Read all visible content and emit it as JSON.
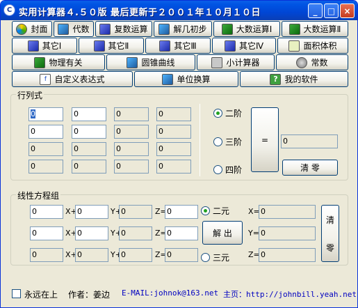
{
  "window": {
    "title": "实用计算器４.５０版  最后更新于２００１年１０月１０日",
    "minimize": "_",
    "maximize": "□",
    "close": "×"
  },
  "toolbar": {
    "row1": [
      "封面",
      "代数",
      "复数运算",
      "解几初步",
      "大数运算Ⅰ",
      "大数运算Ⅱ"
    ],
    "row2": [
      "其它Ⅰ",
      "其它Ⅱ",
      "其它Ⅲ",
      "其它Ⅳ",
      "面积体积"
    ],
    "row3": [
      "物理有关",
      "圆锥曲线",
      "小计算器",
      "常数"
    ],
    "row4": [
      "自定义表达式",
      "单位换算",
      "我的软件"
    ],
    "active_tab": "代数"
  },
  "determinant": {
    "title": "行列式",
    "cells": [
      [
        "0",
        "0",
        "0",
        "0"
      ],
      [
        "0",
        "0",
        "0",
        "0"
      ],
      [
        "0",
        "0",
        "0",
        "0"
      ],
      [
        "0",
        "0",
        "0",
        "0"
      ]
    ],
    "order_options": [
      "二阶",
      "三阶",
      "四阶"
    ],
    "selected_order": "二阶",
    "equals_label": "=",
    "result": "0",
    "clear_label": "清  零"
  },
  "linear": {
    "title": "线性方程组",
    "rows": [
      {
        "a": "0",
        "b": "0",
        "c": "0",
        "d": "0"
      },
      {
        "a": "0",
        "b": "0",
        "c": "0",
        "d": "0"
      },
      {
        "a": "0",
        "b": "0",
        "c": "0",
        "d": "0"
      }
    ],
    "var_labels": [
      "X+",
      "Y+",
      "Z="
    ],
    "mode_options": [
      "二元",
      "三元"
    ],
    "selected_mode": "二元",
    "solve_label": "解  出",
    "results": [
      {
        "label": "X=",
        "value": "0"
      },
      {
        "label": "Y=",
        "value": "0"
      },
      {
        "label": "Z=",
        "value": "0"
      }
    ],
    "clear_label_top": "清",
    "clear_label_bottom": "零"
  },
  "footer": {
    "always_on_top": "永远在上",
    "author": "作者：姜边",
    "email": "E-MAIL:johnok@163.net",
    "homepage": "主页：http://johnbill.yeah.net"
  },
  "colors": {
    "titlebar": "#0054e3",
    "face": "#ece9d8",
    "link": "#0000c0"
  }
}
